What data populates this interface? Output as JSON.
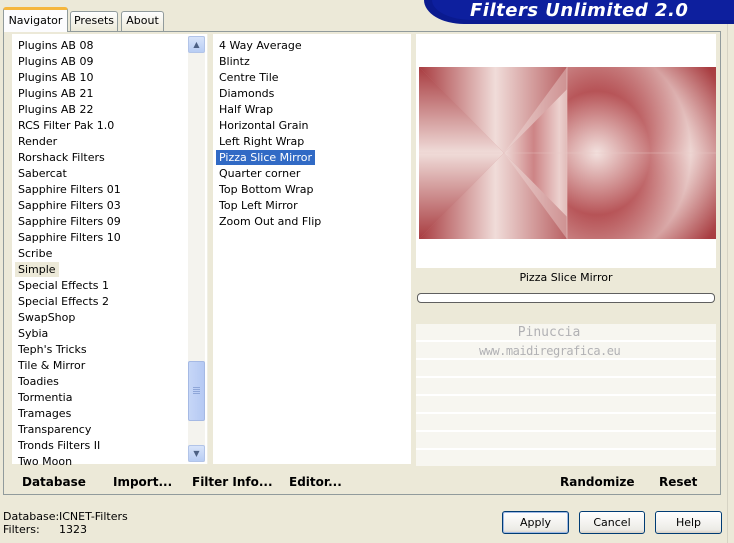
{
  "tabs": [
    {
      "label": "Navigator",
      "active": true
    },
    {
      "label": "Presets",
      "active": false
    },
    {
      "label": "About",
      "active": false
    }
  ],
  "banner": {
    "title": "Filters Unlimited 2.0",
    "color": "#0d1f9e"
  },
  "categories": {
    "items": [
      "Plugins AB 08",
      "Plugins AB 09",
      "Plugins AB 10",
      "Plugins AB 21",
      "Plugins AB 22",
      "RCS Filter Pak 1.0",
      "Render",
      "Rorshack Filters",
      "Sabercat",
      "Sapphire Filters 01",
      "Sapphire Filters 03",
      "Sapphire Filters 09",
      "Sapphire Filters 10",
      "Scribe",
      "Simple",
      "Special Effects 1",
      "Special Effects 2",
      "SwapShop",
      "Sybia",
      "Teph's Tricks",
      "Tile & Mirror",
      "Toadies",
      "Tormentia",
      "Tramages",
      "Transparency",
      "Tronds Filters II",
      "Two Moon"
    ],
    "selected_index": 14,
    "scroll_up_icon": "scroll-up-arrow",
    "scroll_down_icon": "scroll-down-arrow"
  },
  "filters": {
    "items": [
      "4 Way Average",
      "Blintz",
      "Centre Tile",
      "Diamonds",
      "Half Wrap",
      "Horizontal Grain",
      "Left Right Wrap",
      "Pizza Slice Mirror",
      "Quarter corner",
      "Top Bottom Wrap",
      "Top Left Mirror",
      "Zoom Out and Flip"
    ],
    "selected_index": 7,
    "selection_color": "#316ac5"
  },
  "preview": {
    "filter_name": "Pizza Slice Mirror",
    "progress": 0,
    "image_colors": {
      "dark": "#a83c40",
      "light": "#f0dcd9"
    }
  },
  "watermark": {
    "line1": "Pinuccia",
    "line2": "www.maidiregrafica.eu"
  },
  "panel_buttons": {
    "database": "Database",
    "import": "Import...",
    "filter_info": "Filter Info...",
    "editor": "Editor...",
    "randomize": "Randomize",
    "reset": "Reset"
  },
  "status": {
    "database_label": "Database:",
    "database_value": "ICNET-Filters",
    "filters_label": "Filters:",
    "filters_value": "1323"
  },
  "dialog_buttons": {
    "apply": "Apply",
    "cancel": "Cancel",
    "help": "Help"
  }
}
